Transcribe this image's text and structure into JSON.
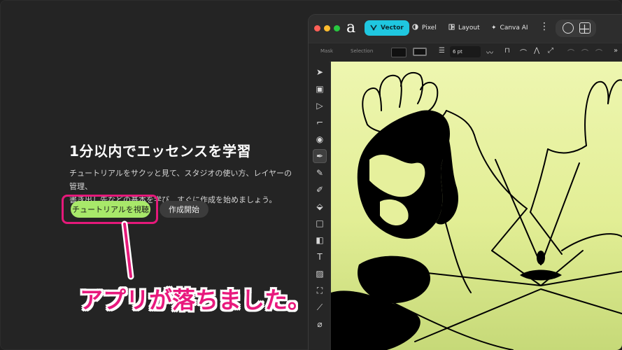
{
  "onboarding": {
    "title": "1分以内でエッセンスを学習",
    "description_line1": "チュートリアルをサクッと見て、スタジオの使い方、レイヤーの管理、",
    "description_line2": "書き出し先などの基本を学び、すぐに作成を始めましょう。",
    "primary_button": "チュートリアルを視聴",
    "secondary_button": "作成開始"
  },
  "annotation": {
    "callout_text": "アプリが落ちました。",
    "color": "#e5197a"
  },
  "app": {
    "logo": "a",
    "tabs": [
      {
        "label": "Vector",
        "active": true
      },
      {
        "label": "Pixel",
        "active": false
      },
      {
        "label": "Layout",
        "active": false
      },
      {
        "label": "Canva AI",
        "active": false
      }
    ],
    "context_bar": {
      "mask_label": "Mask",
      "selection_label": "Selection",
      "stroke_width": "6 pt"
    },
    "tools": [
      "move-tool",
      "artboard-tool",
      "node-tool",
      "corner-tool",
      "point-transform-tool",
      "pen-tool",
      "pencil-tool",
      "vector-brush-tool",
      "fill-tool",
      "rectangle-tool",
      "shape-builder-tool",
      "text-tool",
      "image-tool",
      "crop-tool",
      "measure-tool",
      "color-picker-tool"
    ],
    "accent_color": "#1fc7e0",
    "canvas_color": "#e6f09c"
  }
}
